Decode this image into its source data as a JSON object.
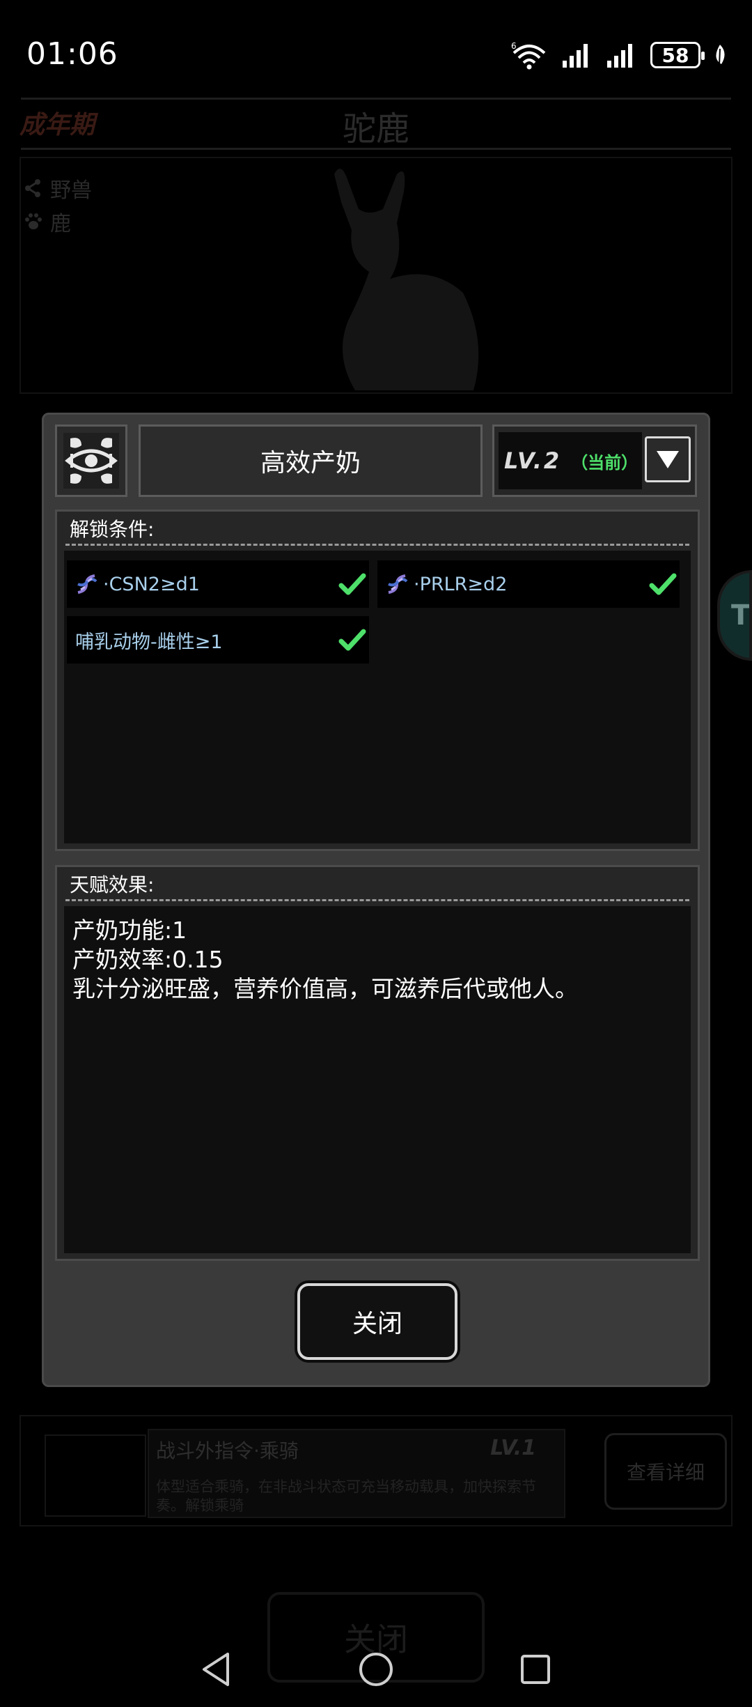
{
  "status_bar": {
    "time": "01:06",
    "battery": "58",
    "network_badge": "6"
  },
  "background": {
    "stage": "成年期",
    "animal_name": "驼鹿",
    "tags": [
      "野兽",
      "鹿"
    ],
    "side_tab_letter": "T",
    "card": {
      "title": "战斗外指令·乘骑",
      "level": "LV.1",
      "desc": "体型适合乘骑，在非战斗状态可充当移动载具，加快探索节奏。解锁乘骑",
      "detail_button": "查看详细"
    },
    "close_button": "关闭"
  },
  "modal": {
    "talent_name": "高效产奶",
    "level": "LV.2",
    "level_current": "（当前）",
    "unlock_title": "解锁条件:",
    "conditions": [
      {
        "text": "·CSN2≥d1",
        "icon": "dna-icon",
        "met": true
      },
      {
        "text": "·PRLR≥d2",
        "icon": "dna-icon",
        "met": true
      },
      {
        "text": "哺乳动物-雌性≥1",
        "icon": "",
        "met": true
      }
    ],
    "effect_title": "天赋效果:",
    "effects": [
      "产奶功能:1",
      "产奶效率:0.15",
      "乳汁分泌旺盛，营养价值高，可滋养后代或他人。"
    ],
    "close_button": "关闭"
  },
  "colors": {
    "accent_green": "#4ee06a",
    "condition_text": "#a9d0ec"
  }
}
